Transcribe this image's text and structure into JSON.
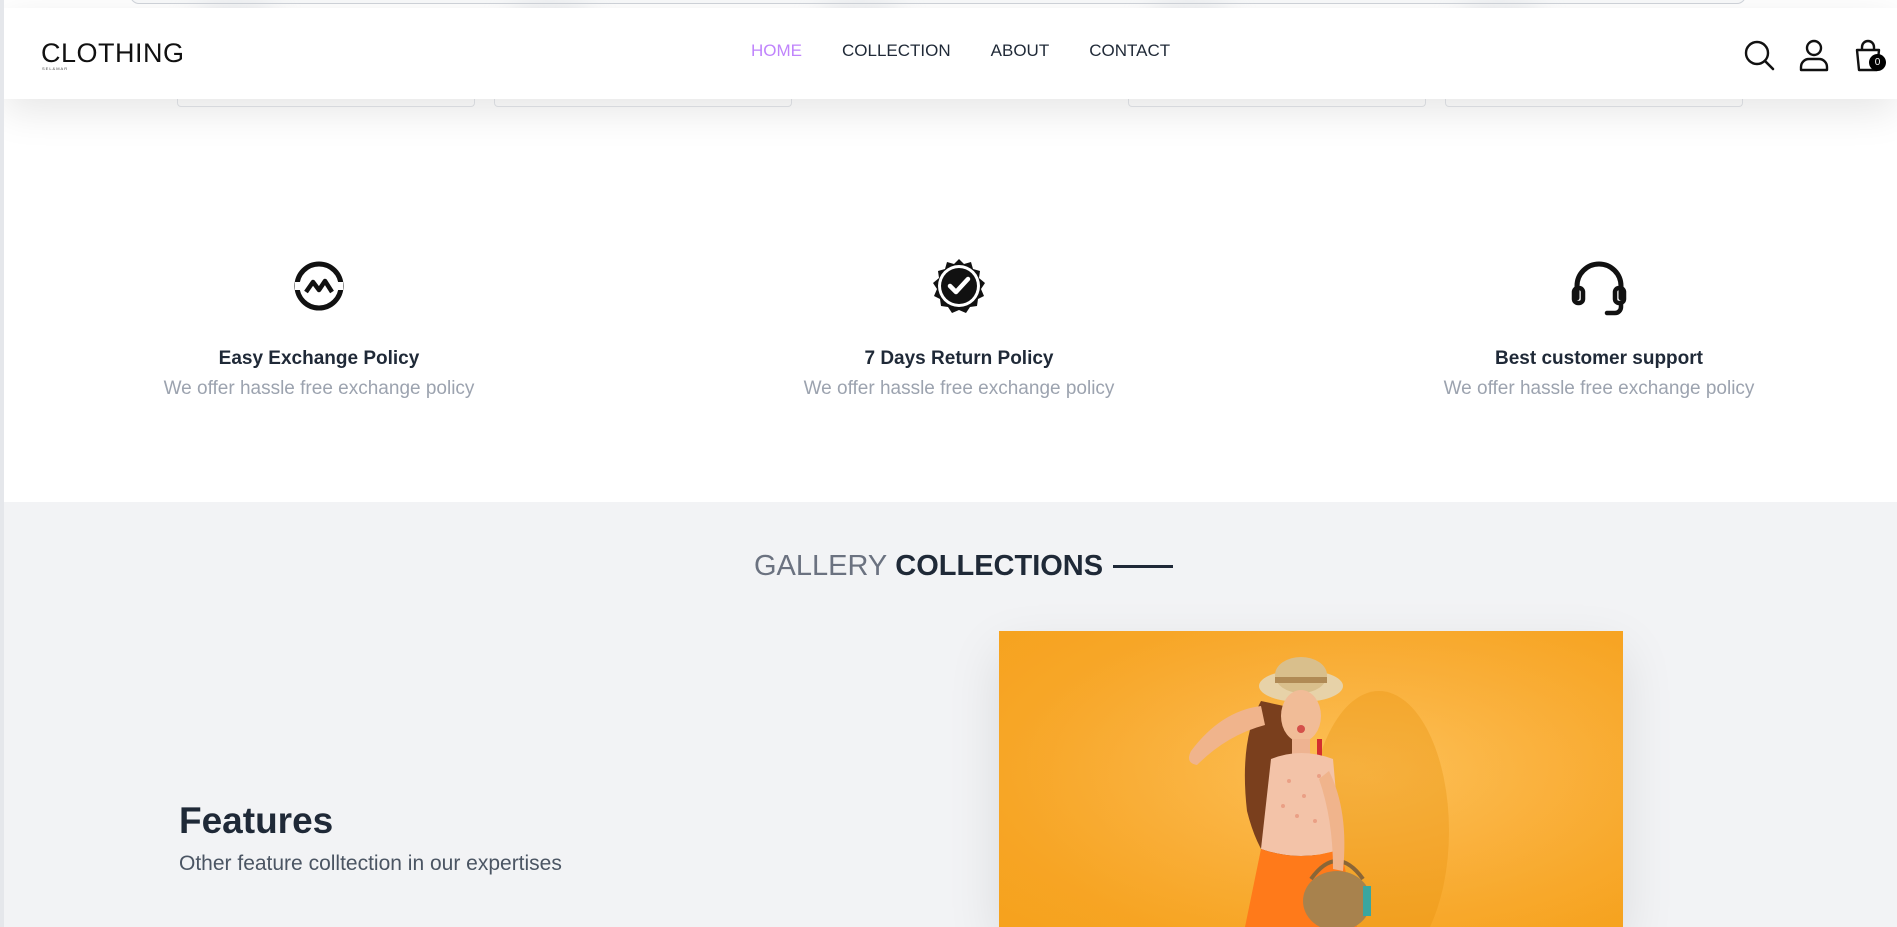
{
  "header": {
    "logo_text": "CLOTHING",
    "logo_subtext": "SEL&MAR",
    "nav": [
      {
        "label": "HOME",
        "active": true
      },
      {
        "label": "COLLECTION",
        "active": false
      },
      {
        "label": "ABOUT",
        "active": false
      },
      {
        "label": "CONTACT",
        "active": false
      }
    ],
    "cart_count": "0",
    "icons": [
      "search-icon",
      "user-icon",
      "shopping-bag-icon"
    ],
    "accent_color": "#c084fc"
  },
  "policies": [
    {
      "icon": "exchange-icon",
      "title": "Easy Exchange Policy",
      "text": "We offer hassle free exchange policy"
    },
    {
      "icon": "verified-badge-icon",
      "title": "7 Days Return Policy",
      "text": "We offer hassle free exchange policy"
    },
    {
      "icon": "headset-icon",
      "title": "Best customer support",
      "text": "We offer hassle free exchange policy"
    }
  ],
  "gallery": {
    "heading_light": "GALLERY",
    "heading_bold": "COLLECTIONS",
    "features_title": "Features",
    "features_subtitle": "Other feature colltection in our expertises",
    "image_description": "woman-in-straw-hat-orange-background"
  }
}
